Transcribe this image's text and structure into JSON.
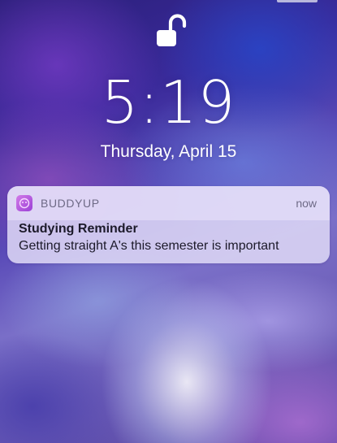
{
  "lockscreen": {
    "lock_icon": "unlocked-padlock-icon",
    "time": "5:19",
    "date": "Thursday, April 15"
  },
  "notification": {
    "app_icon": "buddyup-app-icon",
    "app_name": "BUDDYUP",
    "time": "now",
    "title": "Studying Reminder",
    "body": "Getting straight A's this semester is important"
  }
}
